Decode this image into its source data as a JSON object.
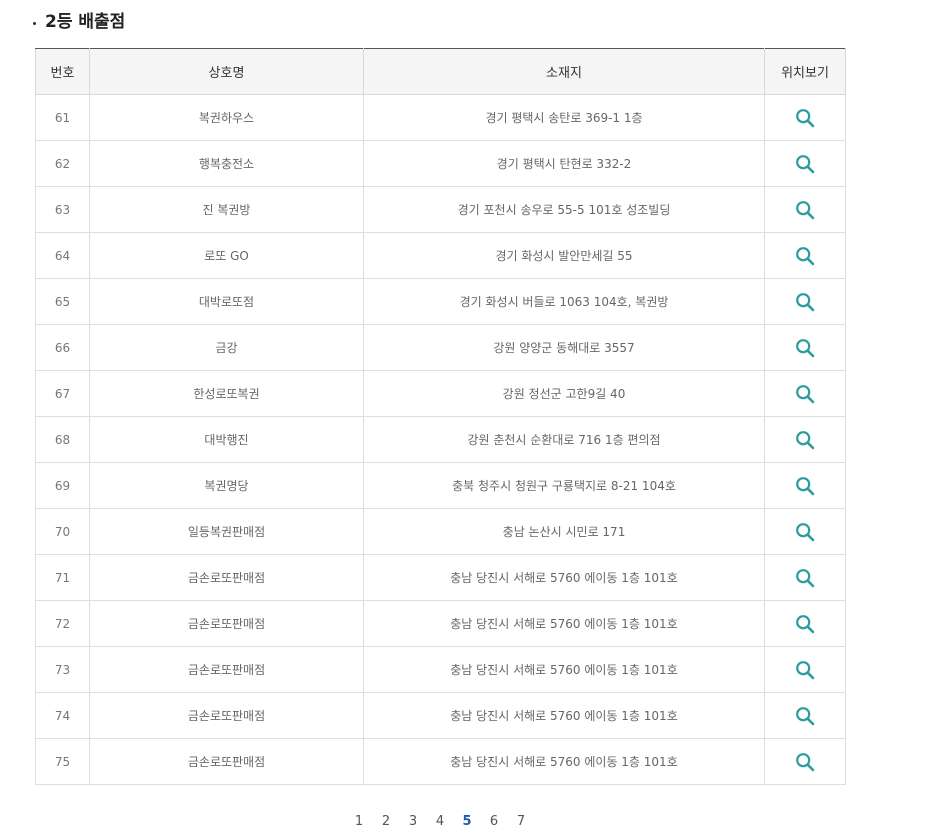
{
  "section": {
    "title": "2등 배출점"
  },
  "table": {
    "headers": [
      "번호",
      "상호명",
      "소재지",
      "위치보기"
    ],
    "rows": [
      {
        "no": "61",
        "name": "복권하우스",
        "address": "경기 평택시 송탄로 369-1 1층"
      },
      {
        "no": "62",
        "name": "행복충전소",
        "address": "경기 평택시 탄현로 332-2"
      },
      {
        "no": "63",
        "name": "진 복권방",
        "address": "경기 포천시 송우로 55-5 101호 성조빌딩"
      },
      {
        "no": "64",
        "name": "로또 GO",
        "address": "경기 화성시 발안만세길 55"
      },
      {
        "no": "65",
        "name": "대박로또점",
        "address": "경기 화성시 버들로 1063 104호, 복권방"
      },
      {
        "no": "66",
        "name": "금강",
        "address": "강원 양양군 동해대로 3557"
      },
      {
        "no": "67",
        "name": "한성로또복권",
        "address": "강원 정선군 고한9길 40"
      },
      {
        "no": "68",
        "name": "대박행진",
        "address": "강원 춘천시 순환대로 716 1층 편의점"
      },
      {
        "no": "69",
        "name": "복권명당",
        "address": "충북 청주시 청원구 구룡택지로 8-21 104호"
      },
      {
        "no": "70",
        "name": "일등복권판매점",
        "address": "충남 논산시 시민로 171"
      },
      {
        "no": "71",
        "name": "금손로또판매점",
        "address": "충남 당진시 서해로 5760 에이동 1층 101호"
      },
      {
        "no": "72",
        "name": "금손로또판매점",
        "address": "충남 당진시 서해로 5760 에이동 1층 101호"
      },
      {
        "no": "73",
        "name": "금손로또판매점",
        "address": "충남 당진시 서해로 5760 에이동 1층 101호"
      },
      {
        "no": "74",
        "name": "금손로또판매점",
        "address": "충남 당진시 서해로 5760 에이동 1층 101호"
      },
      {
        "no": "75",
        "name": "금손로또판매점",
        "address": "충남 당진시 서해로 5760 에이동 1층 101호"
      }
    ],
    "map_icon": "search-icon",
    "map_icon_color": "#2a9d9c"
  },
  "pagination": {
    "pages": [
      "1",
      "2",
      "3",
      "4",
      "5",
      "6",
      "7"
    ],
    "current": "5",
    "active_color": "#1e5ea8"
  }
}
